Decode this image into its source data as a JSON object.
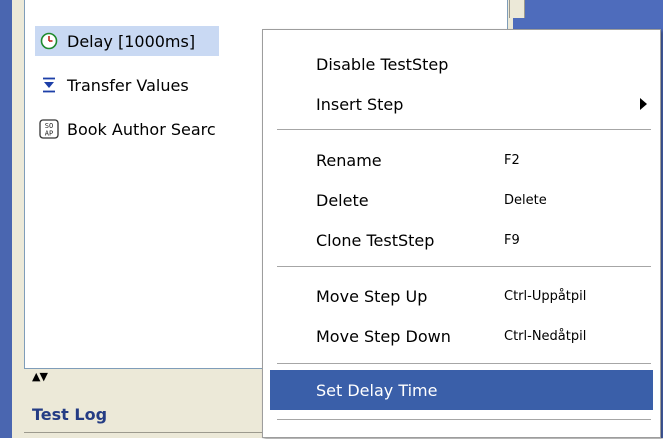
{
  "test_steps": [
    {
      "label": "Delay [1000ms]",
      "icon": "clock-icon",
      "selected": true
    },
    {
      "label": "Transfer Values",
      "icon": "transfer-icon",
      "selected": false
    },
    {
      "label": "Book Author Searc",
      "icon": "soap-icon",
      "selected": false
    }
  ],
  "splitter": {
    "glyph": "▲▼"
  },
  "test_log": {
    "label": "Test Log"
  },
  "context_menu": {
    "items": [
      {
        "label": "Disable TestStep",
        "shortcut": ""
      },
      {
        "label": "Insert Step",
        "shortcut": "",
        "submenu": true
      },
      {
        "label": "Rename",
        "shortcut": "F2"
      },
      {
        "label": "Delete",
        "shortcut": "Delete"
      },
      {
        "label": "Clone TestStep",
        "shortcut": "F9"
      },
      {
        "label": "Move Step Up",
        "shortcut": "Ctrl-Uppåtpil"
      },
      {
        "label": "Move Step Down",
        "shortcut": "Ctrl-Nedåtpil"
      },
      {
        "label": "Set Delay Time",
        "shortcut": "",
        "highlighted": true
      }
    ]
  },
  "colors": {
    "selection_highlight": "#3a5fa9",
    "workspace_blue": "#4e6cbc",
    "step_selected_bg": "#c9d9f3"
  }
}
